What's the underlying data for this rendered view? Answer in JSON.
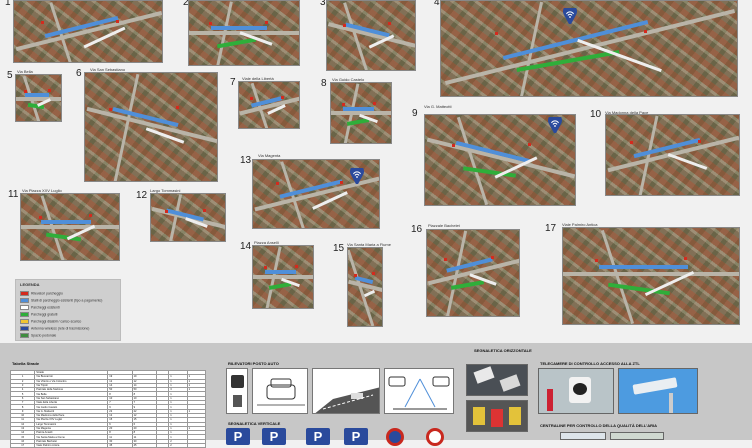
{
  "locations": [
    {
      "num": "1",
      "name": ""
    },
    {
      "num": "2",
      "name": ""
    },
    {
      "num": "3",
      "name": ""
    },
    {
      "num": "4",
      "name": ""
    },
    {
      "num": "5",
      "name": "Via Bella"
    },
    {
      "num": "6",
      "name": "Via San Sebastiano"
    },
    {
      "num": "7",
      "name": "Viale della Libertà"
    },
    {
      "num": "8",
      "name": "Via Guido Castelo"
    },
    {
      "num": "9",
      "name": "Via G. Matteotti"
    },
    {
      "num": "10",
      "name": "Via Madonna della Pace"
    },
    {
      "num": "11",
      "name": "Via Piazza XXV Luglio"
    },
    {
      "num": "12",
      "name": "Largo Tommasini"
    },
    {
      "num": "13",
      "name": "Via Magenta"
    },
    {
      "num": "14",
      "name": "Piazza Anselli"
    },
    {
      "num": "15",
      "name": "Via Santa Maria a Fiume"
    },
    {
      "num": "16",
      "name": "Piazzale Bachelet"
    },
    {
      "num": "17",
      "name": "Viale Palmiro Antica"
    }
  ],
  "legend": {
    "title": "LEGENDA",
    "items": [
      {
        "color": "#d42a1e",
        "text": "Rilevatori parcheggio"
      },
      {
        "color": "#4f8fd9",
        "text": "Stalli di parcheggio esistenti (tipo a pagamento)"
      },
      {
        "color": "#ffffff",
        "text": "Parcheggi esistenti"
      },
      {
        "color": "#2fae3a",
        "text": "Parcheggi gratuiti"
      },
      {
        "color": "#f0c531",
        "text": "Parcheggi disabili / carico-scarico"
      },
      {
        "color": "#2a4a9c",
        "text": "Antenna wireless (rete di trasmissione)"
      },
      {
        "color": "#3f8c3f",
        "text": "Spazio pedonale"
      }
    ]
  },
  "table": {
    "title": "Tabella Strade",
    "header": [
      "",
      "Strade",
      "",
      "",
      "",
      "",
      ""
    ],
    "rows": [
      [
        "1",
        "Via Buonarroti",
        "19",
        "19",
        "",
        "1",
        "1"
      ],
      [
        "2",
        "Via Vittorio e Via Colombo",
        "12",
        "12",
        "",
        "1",
        "1"
      ],
      [
        "3",
        "Via Tripoli",
        "14",
        "14",
        "",
        "1",
        "1"
      ],
      [
        "4",
        "Piazzale della Stazione",
        "50",
        "50",
        "",
        "3",
        "1"
      ],
      [
        "5",
        "Via Bella",
        "8",
        "8",
        "",
        "1",
        ""
      ],
      [
        "6",
        "Via San Sebastiano",
        "10",
        "10",
        "",
        "1",
        ""
      ],
      [
        "7",
        "Viale della Libertà",
        "7",
        "7",
        "",
        "1",
        ""
      ],
      [
        "8",
        "Via Guido Castelo",
        "9",
        "9",
        "",
        "1",
        ""
      ],
      [
        "9",
        "Via G. Matteotti",
        "22",
        "22",
        "",
        "1",
        "1"
      ],
      [
        "10",
        "Via Madonna della Pace",
        "12",
        "12",
        "",
        "1",
        ""
      ],
      [
        "11",
        "Via Piazza XXV Luglio",
        "15",
        "15",
        "",
        "1",
        ""
      ],
      [
        "12",
        "Largo Tommasini",
        "6",
        "6",
        "",
        "1",
        ""
      ],
      [
        "13",
        "Via Magenta",
        "20",
        "20",
        "",
        "1",
        "1"
      ],
      [
        "14",
        "Piazza Anselli",
        "8",
        "8",
        "",
        "1",
        ""
      ],
      [
        "15",
        "Via Santa Maria a Fiume",
        "11",
        "11",
        "",
        "1",
        ""
      ],
      [
        "16",
        "Piazzale Bachelet",
        "30",
        "30",
        "",
        "2",
        ""
      ],
      [
        "17",
        "Viale Palmiro Antica",
        "45",
        "45",
        "",
        "2",
        ""
      ]
    ]
  },
  "sections": {
    "sensors": "RILEVATORI POSTO AUTO",
    "vertical": "SEGNALETICA VERTICALE",
    "horizontal": "SEGNALETICA ORIZZONTALE",
    "cameras": "TELECAMERE DI CONTROLLO ACCESSO ALLA ZTL",
    "air": "CENTRALINE PER CONTROLLO DELLA QUALITÀ DELL'ARIA"
  },
  "signs": [
    "P",
    "P",
    "P",
    "P"
  ],
  "colors": {
    "paid": "#4f8fd9",
    "free": "#2fae3a",
    "sensor": "#d42a1e",
    "wifi": "#2a4a9c",
    "background": "#f1f1f1"
  }
}
